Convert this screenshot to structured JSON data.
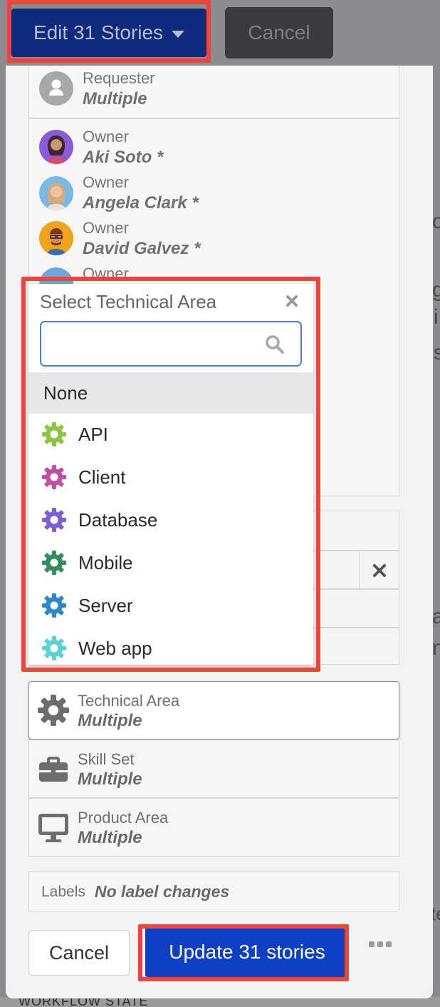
{
  "top_bar": {
    "edit_label": "Edit 31 Stories",
    "cancel_label": "Cancel"
  },
  "requester": {
    "label": "Requester",
    "value": "Multiple"
  },
  "owners": [
    {
      "label": "Owner",
      "name": "Aki Soto *"
    },
    {
      "label": "Owner",
      "name": "Angela Clark *"
    },
    {
      "label": "Owner",
      "name": "David Galvez *"
    },
    {
      "label": "Owner",
      "name": ""
    }
  ],
  "dropdown": {
    "title": "Select Technical Area",
    "search_placeholder": "",
    "options": [
      {
        "label": "None"
      },
      {
        "label": "API",
        "color": "#8cc63f"
      },
      {
        "label": "Client",
        "color": "#c24fa6"
      },
      {
        "label": "Database",
        "color": "#7b5fd8"
      },
      {
        "label": "Mobile",
        "color": "#2f8f5b"
      },
      {
        "label": "Server",
        "color": "#2f86c8"
      },
      {
        "label": "Web app",
        "color": "#5bd3d3"
      }
    ]
  },
  "fields": [
    {
      "label": "Technical Area",
      "value": "Multiple",
      "icon": "gear-icon"
    },
    {
      "label": "Skill Set",
      "value": "Multiple",
      "icon": "briefcase-icon"
    },
    {
      "label": "Product Area",
      "value": "Multiple",
      "icon": "monitor-icon"
    }
  ],
  "labels_row": {
    "label": "Labels",
    "value": "No label changes"
  },
  "footer": {
    "cancel_label": "Cancel",
    "update_label": "Update 31 stories"
  },
  "background": {
    "bottom_text": "WORKFLOW STATE",
    "fragments": [
      "c",
      "g",
      "i",
      "s",
      "a",
      "n",
      "te"
    ]
  }
}
